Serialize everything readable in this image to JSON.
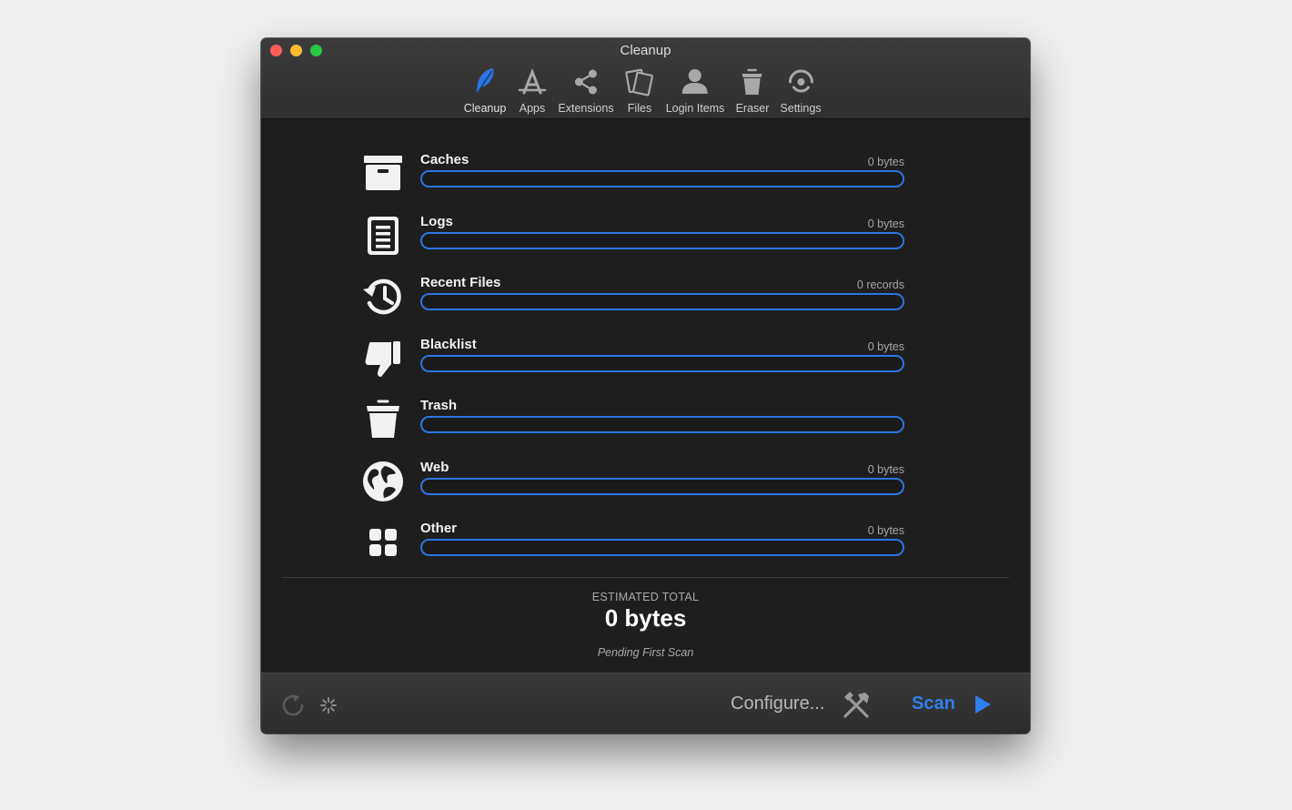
{
  "window": {
    "title": "Cleanup"
  },
  "toolbar": [
    {
      "label": "Cleanup",
      "icon": "feather-icon",
      "active": true
    },
    {
      "label": "Apps",
      "icon": "app-store-icon"
    },
    {
      "label": "Extensions",
      "icon": "share-icon"
    },
    {
      "label": "Files",
      "icon": "files-icon"
    },
    {
      "label": "Login Items",
      "icon": "user-icon"
    },
    {
      "label": "Eraser",
      "icon": "trash-can-icon"
    },
    {
      "label": "Settings",
      "icon": "settings-icon"
    }
  ],
  "categories": [
    {
      "name": "Caches",
      "size": "0 bytes",
      "icon": "archive-box-icon",
      "fill": 0
    },
    {
      "name": "Logs",
      "size": "0 bytes",
      "icon": "document-list-icon",
      "fill": 0
    },
    {
      "name": "Recent Files",
      "size": "0 records",
      "icon": "history-icon",
      "fill": 0
    },
    {
      "name": "Blacklist",
      "size": "0 bytes",
      "icon": "thumbs-down-icon",
      "fill": 0
    },
    {
      "name": "Trash",
      "size": "",
      "icon": "trash-icon",
      "fill": 0
    },
    {
      "name": "Web",
      "size": "0 bytes",
      "icon": "globe-icon",
      "fill": 0
    },
    {
      "name": "Other",
      "size": "0 bytes",
      "icon": "grid-icon",
      "fill": 0
    }
  ],
  "summary": {
    "label": "ESTIMATED TOTAL",
    "value": "0 bytes",
    "status": "Pending First Scan"
  },
  "bottombar": {
    "configure_label": "Configure...",
    "scan_label": "Scan"
  },
  "colors": {
    "accent": "#2d74e0",
    "scan": "#2f80ed",
    "background": "#1e1e1e"
  }
}
